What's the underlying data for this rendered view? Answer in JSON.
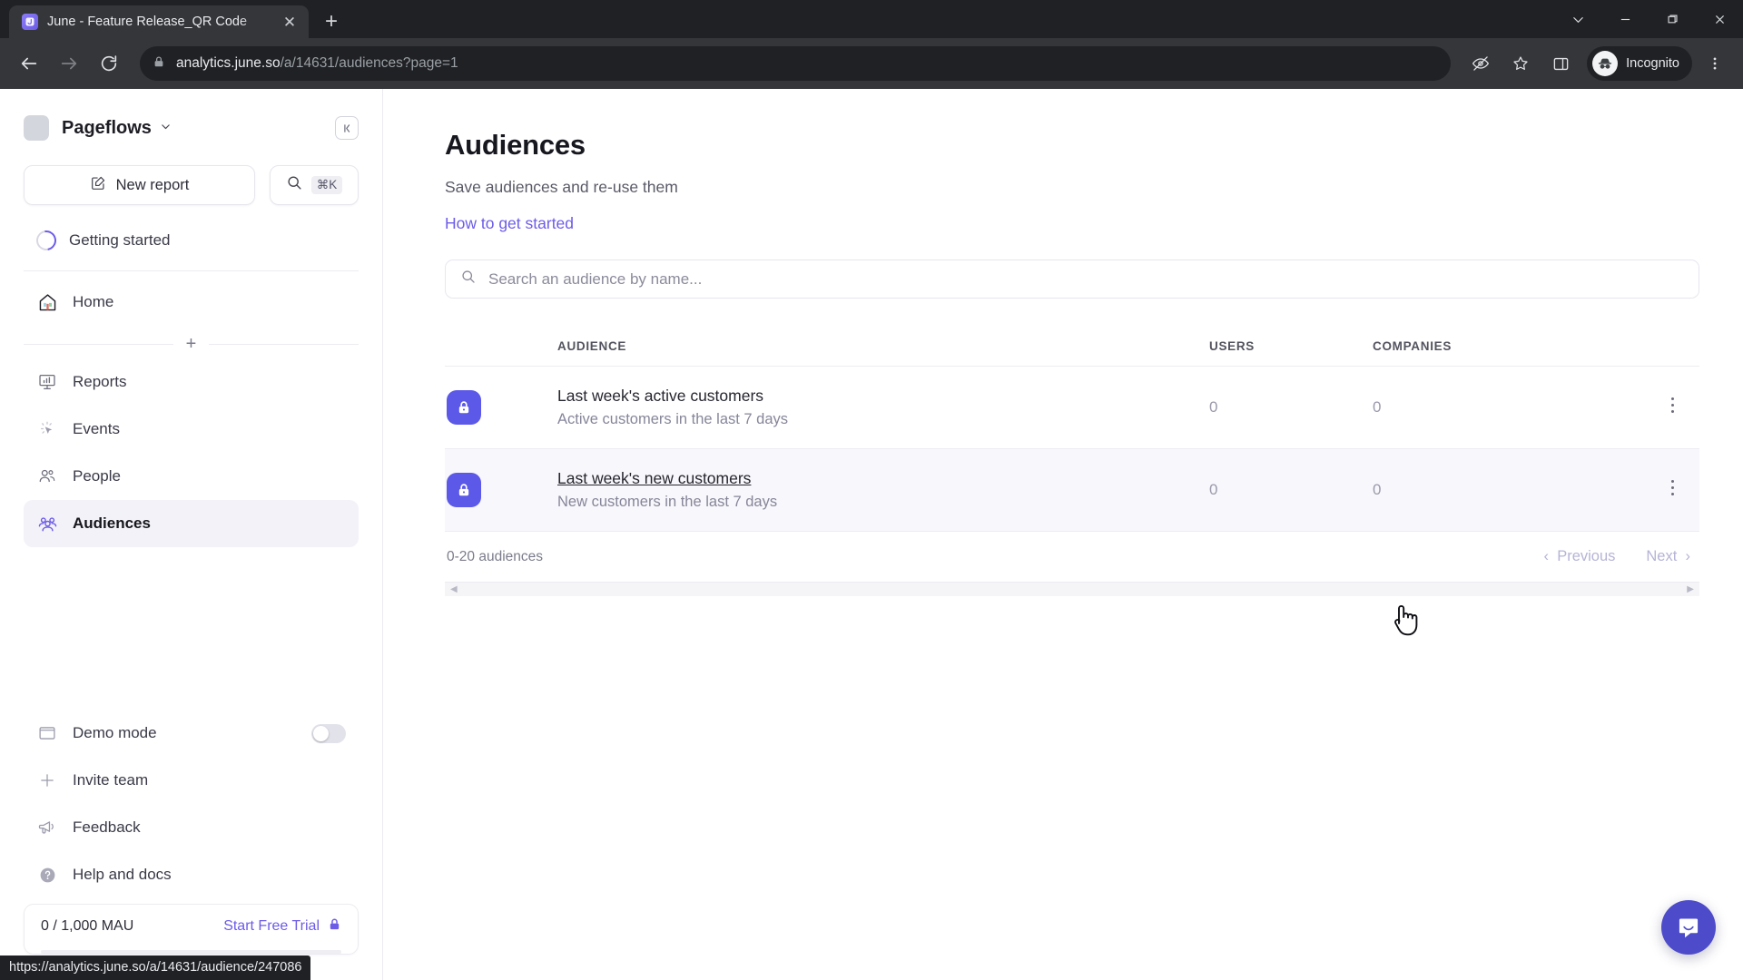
{
  "browser": {
    "tab": {
      "title": "June - Feature Release_QR Code",
      "favicon_icon": "june-logo-icon",
      "close_icon": "close-icon"
    },
    "new_tab_icon": "plus-icon",
    "window_controls": {
      "tab_search_icon": "chevron-down-icon",
      "minimize_icon": "minimize-icon",
      "maximize_icon": "maximize-icon",
      "close_icon": "window-close-icon"
    },
    "nav": {
      "back_icon": "arrow-left-icon",
      "forward_icon": "arrow-right-icon",
      "reload_icon": "reload-icon"
    },
    "omnibox": {
      "lock_icon": "lock-icon",
      "url_domain": "analytics.june.so",
      "url_path": "/a/14631/audiences?page=1"
    },
    "toolbar_icons": {
      "third_party_cookies_icon": "eye-off-icon",
      "bookmark_icon": "star-icon",
      "side_panel_icon": "side-panel-icon",
      "menu_icon": "three-dots-vertical-icon"
    },
    "profile": {
      "label": "Incognito",
      "avatar_icon": "incognito-hat-icon"
    },
    "status_bar_url": "https://analytics.june.so/a/14631/audience/247086"
  },
  "sidebar": {
    "org": {
      "name": "Pageflows",
      "logo_icon": "workspace-logo-icon",
      "caret_icon": "chevron-down-icon",
      "collapse_icon": "collapse-sidebar-icon"
    },
    "new_report": {
      "label": "New report",
      "icon": "edit-square-icon"
    },
    "quick_search": {
      "icon": "search-icon",
      "shortcut": "⌘K"
    },
    "getting_started": {
      "label": "Getting started",
      "icon": "progress-ring-icon"
    },
    "primary_items": [
      {
        "label": "Home",
        "icon": "home-icon",
        "active": false
      }
    ],
    "add_divider_icon": "plus-icon",
    "nav_items": [
      {
        "label": "Reports",
        "icon": "reports-icon",
        "active": false
      },
      {
        "label": "Events",
        "icon": "events-cursor-icon",
        "active": false
      },
      {
        "label": "People",
        "icon": "people-icon",
        "active": false
      },
      {
        "label": "Audiences",
        "icon": "audiences-icon",
        "active": true
      }
    ],
    "bottom_items": [
      {
        "label": "Demo mode",
        "icon": "demo-mode-icon",
        "toggle": true,
        "toggle_on": false
      },
      {
        "label": "Invite team",
        "icon": "plus-icon",
        "toggle": false
      },
      {
        "label": "Feedback",
        "icon": "megaphone-icon",
        "toggle": false
      },
      {
        "label": "Help and docs",
        "icon": "help-circle-icon",
        "toggle": false
      }
    ],
    "mau": {
      "count_label": "0 / 1,000 MAU",
      "cta_label": "Start Free Trial",
      "cta_icon": "lock-icon",
      "progress_percent": 0
    }
  },
  "main": {
    "title": "Audiences",
    "subtitle": "Save audiences and re-use them",
    "help_link": "How to get started",
    "search": {
      "icon": "search-icon",
      "placeholder": "Search an audience by name..."
    },
    "table": {
      "columns": {
        "audience": "AUDIENCE",
        "users": "USERS",
        "companies": "COMPANIES"
      },
      "rows": [
        {
          "icon": "lock-badge-icon",
          "name": "Last week's active customers",
          "description": "Active customers in the last 7 days",
          "users": "0",
          "companies": "0",
          "menu_icon": "kebab-menu-icon",
          "hovered": false
        },
        {
          "icon": "lock-badge-icon",
          "name": "Last week's new customers",
          "description": "New customers in the last 7 days",
          "users": "0",
          "companies": "0",
          "menu_icon": "kebab-menu-icon",
          "hovered": true
        }
      ],
      "footer": {
        "count_label": "0-20 audiences",
        "previous_label": "Previous",
        "previous_icon": "chevron-left-icon",
        "next_label": "Next",
        "next_icon": "chevron-right-icon"
      },
      "hscroll": {
        "left_icon": "scroll-left-icon",
        "right_icon": "scroll-right-icon"
      }
    },
    "intercom_icon": "intercom-messenger-icon",
    "cursor_icon": "pointer-hand-cursor"
  },
  "colors": {
    "accent": "#6c5ce7",
    "badge": "#5c58e8",
    "row_hover": "#f8f7fb",
    "chrome_dark": "#202124"
  }
}
